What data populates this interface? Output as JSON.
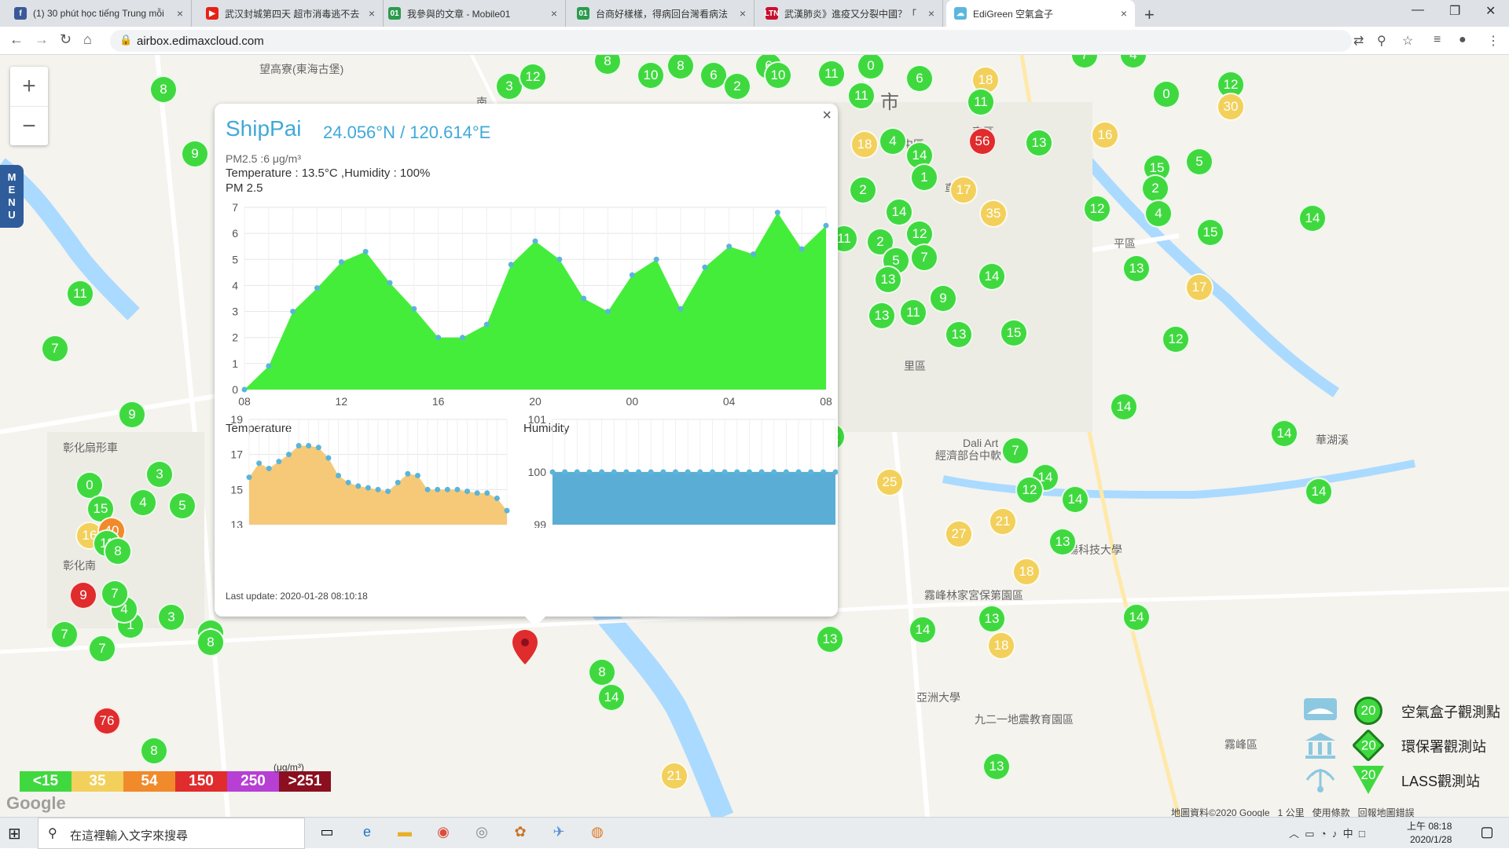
{
  "browser": {
    "tabs": [
      {
        "title": "(1) 30 phút học tiếng Trung mỗi",
        "favicon": "facebook-icon",
        "color": "#3b5998",
        "glyph": "f"
      },
      {
        "title": "武汉封城第四天 超市消毒逃不去",
        "favicon": "youtube-icon",
        "color": "#e62117",
        "glyph": "▶"
      },
      {
        "title": "我參與的文章 - Mobile01",
        "favicon": "mobile01-icon",
        "color": "#2b9b4d",
        "glyph": "01"
      },
      {
        "title": "台商好樣樣，得病回台灣看病法",
        "favicon": "mobile01-icon",
        "color": "#2b9b4d",
        "glyph": "01"
      },
      {
        "title": "武漢肺炎》進疫又分裂中國？「",
        "favicon": "ltn-icon",
        "color": "#c8102e",
        "glyph": "LTN"
      },
      {
        "title": "EdiGreen 空氣盒子",
        "favicon": "edigreen-icon",
        "color": "#5bb7de",
        "glyph": "☁"
      }
    ],
    "url": "airbox.edimaxcloud.com"
  },
  "map": {
    "zoom_in": "+",
    "zoom_out": "−",
    "menu_label": [
      "M",
      "E",
      "N",
      "U"
    ],
    "legend": [
      {
        "label": "<15",
        "color": "#3fd93f"
      },
      {
        "label": "35",
        "color": "#f2d05b"
      },
      {
        "label": "54",
        "color": "#f08a2a"
      },
      {
        "label": "150",
        "color": "#e02c2c"
      },
      {
        "label": "250",
        "color": "#b73fd4"
      },
      {
        "label": ">251",
        "color": "#8b0f1f"
      }
    ],
    "legend_unit": "(μg/m³)",
    "type_legend": [
      {
        "label": "空氣盒子觀測點",
        "marker": "20",
        "icon": "airbox-icon"
      },
      {
        "label": "環保署觀測站",
        "marker": "20",
        "icon": "epa-station-icon"
      },
      {
        "label": "LASS觀測站",
        "marker": "20",
        "icon": "lass-station-icon"
      }
    ],
    "attribution": "地圖資料©2020 Google",
    "scale": "1 公里",
    "terms": "使用條款",
    "report": "回報地圖錯誤",
    "google_logo": "Google",
    "labels": [
      "望高寮(東海古堡)",
      "南",
      "市",
      "中區",
      "東區",
      "車站",
      "平區",
      "里區",
      "彰化扇形車",
      "彰化南",
      "Dali Art",
      "霧峰林家宮保第園區",
      "亞洲大學",
      "九二一地震教育園區",
      "霧峰區",
      "陽科技大學",
      "經濟部台中軟",
      "華湖溪"
    ],
    "markers": [
      {
        "v": "8",
        "c": "green"
      },
      {
        "v": "9",
        "c": "green"
      },
      {
        "v": "3",
        "c": "green"
      },
      {
        "v": "12",
        "c": "green"
      },
      {
        "v": "8",
        "c": "green"
      },
      {
        "v": "10",
        "c": "green"
      },
      {
        "v": "8",
        "c": "green"
      },
      {
        "v": "6",
        "c": "green"
      },
      {
        "v": "2",
        "c": "green"
      },
      {
        "v": "6",
        "c": "green"
      },
      {
        "v": "10",
        "c": "green"
      },
      {
        "v": "11",
        "c": "green"
      },
      {
        "v": "0",
        "c": "green"
      },
      {
        "v": "6",
        "c": "green"
      },
      {
        "v": "11",
        "c": "green"
      },
      {
        "v": "18",
        "c": "yellow"
      },
      {
        "v": "7",
        "c": "green"
      },
      {
        "v": "4",
        "c": "green"
      },
      {
        "v": "0",
        "c": "green"
      },
      {
        "v": "12",
        "c": "green"
      },
      {
        "v": "30",
        "c": "yellow"
      },
      {
        "v": "11",
        "c": "green"
      },
      {
        "v": "18",
        "c": "yellow"
      },
      {
        "v": "4",
        "c": "green"
      },
      {
        "v": "14",
        "c": "green"
      },
      {
        "v": "56",
        "c": "red"
      },
      {
        "v": "13",
        "c": "green"
      },
      {
        "v": "16",
        "c": "yellow"
      },
      {
        "v": "15",
        "c": "green"
      },
      {
        "v": "5",
        "c": "green"
      },
      {
        "v": "1",
        "c": "green"
      },
      {
        "v": "17",
        "c": "yellow"
      },
      {
        "v": "2",
        "c": "green"
      },
      {
        "v": "2",
        "c": "green"
      },
      {
        "v": "14",
        "c": "green"
      },
      {
        "v": "35",
        "c": "yellow"
      },
      {
        "v": "12",
        "c": "green"
      },
      {
        "v": "4",
        "c": "green"
      },
      {
        "v": "14",
        "c": "green"
      },
      {
        "v": "12",
        "c": "green"
      },
      {
        "v": "15",
        "c": "green"
      },
      {
        "v": "11",
        "c": "green"
      },
      {
        "v": "2",
        "c": "green"
      },
      {
        "v": "5",
        "c": "green"
      },
      {
        "v": "7",
        "c": "green"
      },
      {
        "v": "13",
        "c": "green"
      },
      {
        "v": "14",
        "c": "green"
      },
      {
        "v": "13",
        "c": "green"
      },
      {
        "v": "17",
        "c": "yellow"
      },
      {
        "v": "11",
        "c": "green"
      },
      {
        "v": "9",
        "c": "green"
      },
      {
        "v": "13",
        "c": "green"
      },
      {
        "v": "15",
        "c": "green"
      },
      {
        "v": "12",
        "c": "green"
      },
      {
        "v": "13",
        "c": "green"
      },
      {
        "v": "14",
        "c": "green"
      },
      {
        "v": "7",
        "c": "green"
      },
      {
        "v": "25",
        "c": "yellow"
      },
      {
        "v": "14",
        "c": "green"
      },
      {
        "v": "12",
        "c": "green"
      },
      {
        "v": "14",
        "c": "green"
      },
      {
        "v": "14",
        "c": "green"
      },
      {
        "v": "21",
        "c": "yellow"
      },
      {
        "v": "14",
        "c": "green"
      },
      {
        "v": "27",
        "c": "yellow"
      },
      {
        "v": "13",
        "c": "green"
      },
      {
        "v": "18",
        "c": "yellow"
      },
      {
        "v": "13",
        "c": "green"
      },
      {
        "v": "14",
        "c": "green"
      },
      {
        "v": "13",
        "c": "green"
      },
      {
        "v": "18",
        "c": "yellow"
      },
      {
        "v": "13",
        "c": "green"
      },
      {
        "v": "8",
        "c": "green"
      },
      {
        "v": "14",
        "c": "green"
      },
      {
        "v": "21",
        "c": "yellow"
      },
      {
        "v": "13",
        "c": "green"
      },
      {
        "v": "13",
        "c": "green"
      },
      {
        "v": "9",
        "c": "green"
      },
      {
        "v": "0",
        "c": "green"
      },
      {
        "v": "3",
        "c": "green"
      },
      {
        "v": "15",
        "c": "green"
      },
      {
        "v": "4",
        "c": "green"
      },
      {
        "v": "5",
        "c": "green"
      },
      {
        "v": "16",
        "c": "yellow"
      },
      {
        "v": "40",
        "c": "orange"
      },
      {
        "v": "11",
        "c": "green"
      },
      {
        "v": "8",
        "c": "green"
      },
      {
        "v": "9",
        "c": "red"
      },
      {
        "v": "1",
        "c": "green"
      },
      {
        "v": "3",
        "c": "green"
      },
      {
        "v": "7",
        "c": "green"
      },
      {
        "v": "7",
        "c": "green"
      },
      {
        "v": "8",
        "c": "green"
      },
      {
        "v": "76",
        "c": "red"
      },
      {
        "v": "8",
        "c": "green"
      },
      {
        "v": "8",
        "c": "green"
      },
      {
        "v": "11",
        "c": "green"
      },
      {
        "v": "7",
        "c": "green"
      },
      {
        "v": "4",
        "c": "green"
      },
      {
        "v": "7",
        "c": "green"
      },
      {
        "v": "12",
        "c": "green"
      },
      {
        "v": "14",
        "c": "green"
      }
    ]
  },
  "popup": {
    "station_name": "ShipPai",
    "coords": "24.056°N / 120.614°E",
    "pm25_line": "PM2.5 :6 μg/m³",
    "temp_hum_line": "Temperature : 13.5°C ,Humidity : 100%",
    "chart_title": "PM 2.5",
    "temp_title": "Temperature",
    "hum_title": "Humidity",
    "last_update": "Last update: 2020-01-28 08:10:18",
    "close": "×"
  },
  "chart_data": [
    {
      "type": "area",
      "title": "PM 2.5",
      "xlabel": "",
      "ylabel": "",
      "ylim": [
        0,
        7
      ],
      "yticks": [
        0,
        1,
        2,
        3,
        4,
        5,
        6,
        7
      ],
      "xticks": [
        "08",
        "12",
        "16",
        "20",
        "00",
        "04",
        "08"
      ],
      "color": "#45ed3b",
      "values": [
        0,
        0.9,
        3.0,
        3.9,
        4.9,
        5.3,
        4.1,
        3.1,
        2.0,
        2.0,
        2.5,
        4.8,
        5.7,
        5.0,
        3.5,
        3.0,
        4.4,
        5.0,
        3.1,
        4.7,
        5.5,
        5.2,
        6.8,
        5.4,
        6.3
      ]
    },
    {
      "type": "area",
      "title": "Temperature",
      "ylim": [
        13,
        19
      ],
      "yticks": [
        13,
        15,
        17,
        19
      ],
      "color": "#f6c978",
      "values": [
        15.7,
        16.5,
        16.2,
        16.6,
        17.0,
        17.5,
        17.5,
        17.4,
        16.8,
        15.8,
        15.4,
        15.2,
        15.1,
        15.0,
        14.9,
        15.4,
        15.9,
        15.8,
        15.0,
        15.0,
        15.0,
        15.0,
        14.9,
        14.8,
        14.8,
        14.5,
        13.8
      ]
    },
    {
      "type": "area",
      "title": "Humidity",
      "ylim": [
        99,
        101
      ],
      "yticks": [
        99,
        100,
        101
      ],
      "color": "#5aaed6",
      "values": [
        100,
        100,
        100,
        100,
        100,
        100,
        100,
        100,
        100,
        100,
        100,
        100,
        100,
        100,
        100,
        100,
        100,
        100,
        100,
        100,
        100,
        100,
        100,
        100
      ]
    }
  ],
  "taskbar": {
    "search_placeholder": "在這裡輸入文字來搜尋",
    "time": "上午 08:18",
    "date": "2020/1/28",
    "ime": "中"
  }
}
